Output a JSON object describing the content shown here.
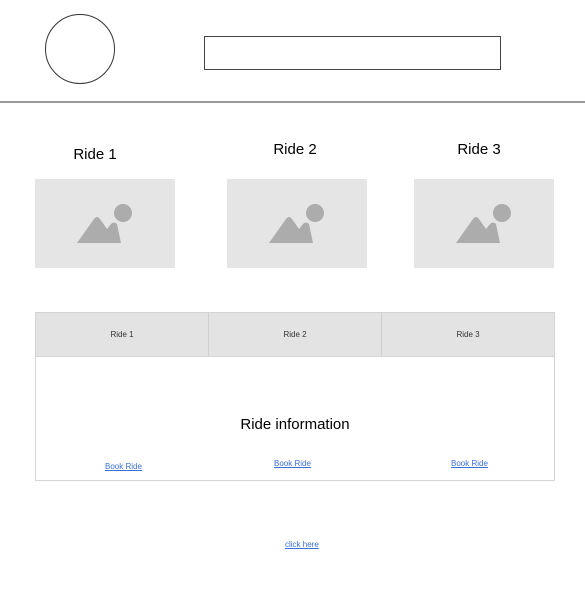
{
  "header": {
    "search_placeholder": ""
  },
  "rides": [
    {
      "title": "Ride 1",
      "image_icon": "image-placeholder-icon"
    },
    {
      "title": "Ride 2",
      "image_icon": "image-placeholder-icon"
    },
    {
      "title": "Ride 3",
      "image_icon": "image-placeholder-icon"
    }
  ],
  "tabs": {
    "items": [
      {
        "label": "Ride 1"
      },
      {
        "label": "Ride 2"
      },
      {
        "label": "Ride 3"
      }
    ],
    "panel_heading": "Ride information",
    "book_links": [
      {
        "label": "Book Ride"
      },
      {
        "label": "Book Ride"
      },
      {
        "label": "Book Ride"
      }
    ]
  },
  "footer": {
    "link_label": "click here "
  },
  "colors": {
    "placeholder_bg": "#e5e5e5",
    "placeholder_icon": "#acacac",
    "tab_bg": "#e3e3e3",
    "link": "#3a6fd8"
  }
}
